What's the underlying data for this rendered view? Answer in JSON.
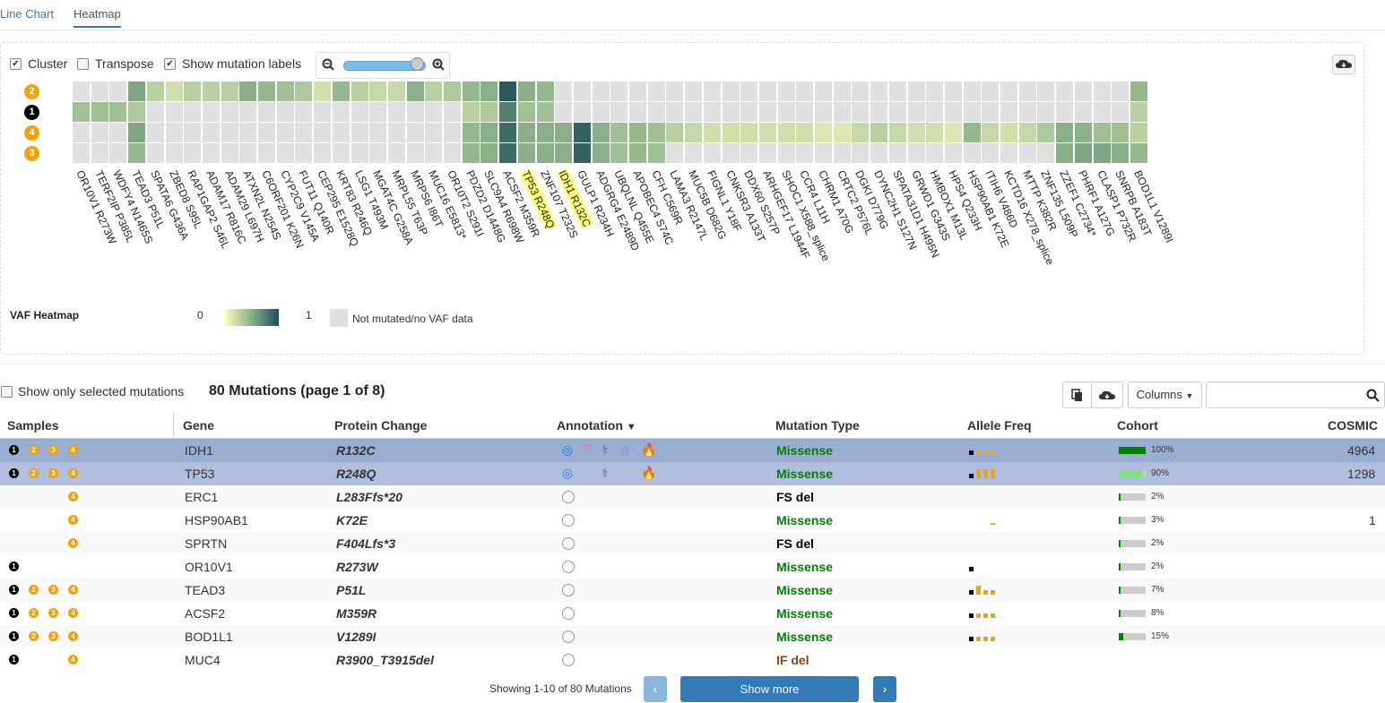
{
  "tabs": [
    {
      "label": "Line Chart"
    },
    {
      "label": "Heatmap"
    }
  ],
  "controls": {
    "cluster": "Cluster",
    "transpose": "Transpose",
    "show_labels": "Show mutation labels"
  },
  "colors": {
    "accent": "#337ab7",
    "missense": "#008000",
    "fsdel": "#000000",
    "ifdel": "#8b4513",
    "badge_orange": "#f0a30a",
    "badge_black": "#000000"
  },
  "samples": [
    "2",
    "1",
    "4",
    "3"
  ],
  "mutations": [
    "OR10V1 R273W",
    "TERF2IP P385L",
    "WDFY4 N1465S",
    "TEAD3 P51L",
    "SPATA6 G436A",
    "ZBED8 S95L",
    "RAP1GAP2 S46L",
    "ADAM17 R816C",
    "ADAM29 L697H",
    "ATXN2L N254S",
    "C6ORF201 K26N",
    "CYP2C9 V145A",
    "FUT11 Q140R",
    "CEP295 E1528Q",
    "KRT83 R246Q",
    "LSG1 T493M",
    "MGAT4C G258A",
    "MRPL55 T63P",
    "MRPS6 I86T",
    "MUC16 E5813*",
    "OR10T2 S291I",
    "PDZD2 D1448G",
    "SLC9A4 R698W",
    "ACSF2 M359R",
    "TP53 R248Q",
    "ZNF107 T232S",
    "IDH1 R132C",
    "GULP1 R234H",
    "ADGRG4 E2489D",
    "UBQLNL Q455E",
    "APOBEC4 S74C",
    "CFH C569R",
    "LAMA3 R2147L",
    "MUC5B D682G",
    "FIGNL1 Y18F",
    "CNKSR3 A133T",
    "DDX60 S257P",
    "ARHGEF17 L1944F",
    "SHOC1 X588_splice",
    "CCR4 L11H",
    "CHRM1 A70G",
    "CRTC2 P576L",
    "DGKI D779G",
    "DYNC2H1 S127N",
    "SPATA31D1 H495N",
    "GRWD1 G343S",
    "HMBOX1 M13L",
    "HPS4 Q233H",
    "HSP90AB1 K72E",
    "ITIH6 V486D",
    "KCTD16 X278_splice",
    "MTTP K382R",
    "ZNF135 L509P",
    "ZZEF1 C2734*",
    "PHRF1 A127G",
    "CLASP1 P732R",
    "SNRPB A183T",
    "BOD1L1 V1289I"
  ],
  "heatmap": {
    "rows": [
      [
        -1,
        -1,
        -1,
        0.55,
        0.3,
        0.2,
        0.3,
        0.3,
        0.3,
        0.5,
        0.45,
        0.4,
        0.35,
        0.2,
        0.45,
        0.3,
        0.25,
        0.25,
        0.5,
        0.3,
        0.35,
        0.45,
        0.5,
        0.95,
        0.5,
        0.45,
        -1,
        -1,
        -1,
        -1,
        -1,
        -1,
        -1,
        -1,
        -1,
        -1,
        -1,
        -1,
        -1,
        -1,
        -1,
        -1,
        -1,
        -1,
        -1,
        -1,
        -1,
        -1,
        -1,
        -1,
        -1,
        -1,
        -1,
        -1,
        -1,
        -1,
        -1,
        0.45
      ],
      [
        0.4,
        0.4,
        0.4,
        0.35,
        -1,
        -1,
        -1,
        -1,
        -1,
        -1,
        -1,
        -1,
        -1,
        -1,
        -1,
        -1,
        -1,
        -1,
        -1,
        -1,
        -1,
        0.3,
        0.35,
        0.75,
        0.4,
        0.4,
        -1,
        -1,
        -1,
        -1,
        -1,
        -1,
        -1,
        -1,
        -1,
        -1,
        -1,
        -1,
        -1,
        -1,
        -1,
        -1,
        -1,
        -1,
        -1,
        -1,
        -1,
        -1,
        -1,
        -1,
        -1,
        -1,
        -1,
        -1,
        -1,
        -1,
        -1,
        0.3
      ],
      [
        -1,
        -1,
        -1,
        0.55,
        -1,
        -1,
        -1,
        -1,
        -1,
        -1,
        -1,
        -1,
        -1,
        -1,
        -1,
        -1,
        -1,
        -1,
        -1,
        -1,
        -1,
        0.45,
        0.5,
        0.85,
        0.5,
        0.5,
        0.5,
        0.9,
        0.5,
        0.4,
        0.45,
        0.4,
        0.3,
        0.25,
        0.2,
        0.2,
        0.2,
        0.2,
        0.2,
        0.2,
        0.15,
        0.15,
        0.25,
        0.3,
        0.25,
        0.2,
        0.2,
        0.15,
        0.45,
        0.25,
        0.2,
        0.25,
        0.35,
        0.5,
        0.5,
        0.4,
        0.4,
        0.3
      ],
      [
        -1,
        -1,
        -1,
        0.45,
        -1,
        -1,
        -1,
        -1,
        -1,
        -1,
        -1,
        -1,
        -1,
        -1,
        -1,
        -1,
        -1,
        -1,
        -1,
        -1,
        -1,
        0.45,
        0.5,
        0.85,
        0.5,
        0.5,
        0.5,
        0.9,
        0.5,
        0.4,
        0.45,
        0.4,
        -1,
        -1,
        -1,
        -1,
        -1,
        -1,
        -1,
        -1,
        -1,
        -1,
        -1,
        -1,
        -1,
        -1,
        -1,
        -1,
        -1,
        -1,
        -1,
        -1,
        -1,
        0.5,
        0.55,
        0.55,
        0.5,
        0.45
      ]
    ],
    "highlighted": [
      "TP53 R248Q",
      "IDH1 R132C"
    ]
  },
  "legend": {
    "title": "VAF Heatmap",
    "min": "0",
    "max": "1",
    "na": "Not mutated/no VAF data"
  },
  "table": {
    "show_selected": "Show only selected mutations",
    "count_title": "80 Mutations (page 1 of 8)",
    "columns_btn": "Columns",
    "headers": {
      "samples": "Samples",
      "gene": "Gene",
      "protein": "Protein Change",
      "annotation": "Annotation",
      "mtype": "Mutation Type",
      "af": "Allele Freq",
      "cohort": "Cohort",
      "cosmic": "COSMIC"
    },
    "rows": [
      {
        "samples": [
          "1",
          "2",
          "3",
          "4"
        ],
        "gene": "IDH1",
        "protein": "R132C",
        "mtype": "Missense",
        "cohort_pct": "100%",
        "cohort": 1.0,
        "cosmic": "4964",
        "af": [
          1,
          1,
          1,
          1
        ],
        "anno": "full",
        "selected": true
      },
      {
        "samples": [
          "1",
          "2",
          "3",
          "4"
        ],
        "gene": "TP53",
        "protein": "R248Q",
        "mtype": "Missense",
        "cohort_pct": "90%",
        "cohort": 0.9,
        "cosmic": "1298",
        "af": [
          1,
          2,
          2,
          2
        ],
        "anno": "partial",
        "selected": true
      },
      {
        "samples": [
          "4"
        ],
        "gene": "ERC1",
        "protein": "L283Ffs*20",
        "mtype": "FS del",
        "cohort_pct": "2%",
        "cohort": 0.02,
        "cosmic": "",
        "af": [],
        "anno": "none",
        "selected": false
      },
      {
        "samples": [
          "4"
        ],
        "gene": "HSP90AB1",
        "protein": "K72E",
        "mtype": "Missense",
        "cohort_pct": "3%",
        "cohort": 0.03,
        "cosmic": "1",
        "af": [
          0,
          0,
          0,
          0.2
        ],
        "anno": "none",
        "selected": false
      },
      {
        "samples": [
          "4"
        ],
        "gene": "SPRTN",
        "protein": "F404Lfs*3",
        "mtype": "FS del",
        "cohort_pct": "2%",
        "cohort": 0.02,
        "cosmic": "",
        "af": [],
        "anno": "none",
        "selected": false
      },
      {
        "samples": [
          "1"
        ],
        "gene": "OR10V1",
        "protein": "R273W",
        "mtype": "Missense",
        "cohort_pct": "2%",
        "cohort": 0.02,
        "cosmic": "",
        "af": [
          1
        ],
        "anno": "none",
        "selected": false
      },
      {
        "samples": [
          "1",
          "2",
          "3",
          "4"
        ],
        "gene": "TEAD3",
        "protein": "P51L",
        "mtype": "Missense",
        "cohort_pct": "7%",
        "cohort": 0.07,
        "cosmic": "",
        "af": [
          1,
          2,
          1,
          1
        ],
        "anno": "none",
        "selected": false
      },
      {
        "samples": [
          "1",
          "2",
          "3",
          "4"
        ],
        "gene": "ACSF2",
        "protein": "M359R",
        "mtype": "Missense",
        "cohort_pct": "8%",
        "cohort": 0.08,
        "cosmic": "",
        "af": [
          1,
          1,
          1,
          1
        ],
        "anno": "none",
        "selected": false
      },
      {
        "samples": [
          "1",
          "2",
          "3",
          "4"
        ],
        "gene": "BOD1L1",
        "protein": "V1289I",
        "mtype": "Missense",
        "cohort_pct": "15%",
        "cohort": 0.15,
        "cosmic": "",
        "af": [
          1,
          1,
          1,
          1
        ],
        "anno": "none",
        "selected": false
      },
      {
        "samples": [
          "1",
          "4"
        ],
        "gene": "MUC4",
        "protein": "R3900_T3915del",
        "mtype": "IF del",
        "cohort_pct": "",
        "cohort": 0,
        "cosmic": "",
        "af": [],
        "anno": "none",
        "selected": false
      }
    ],
    "footer": "Showing 1-10 of 80 Mutations",
    "show_more": "Show more",
    "prev": "‹",
    "next": "›"
  }
}
